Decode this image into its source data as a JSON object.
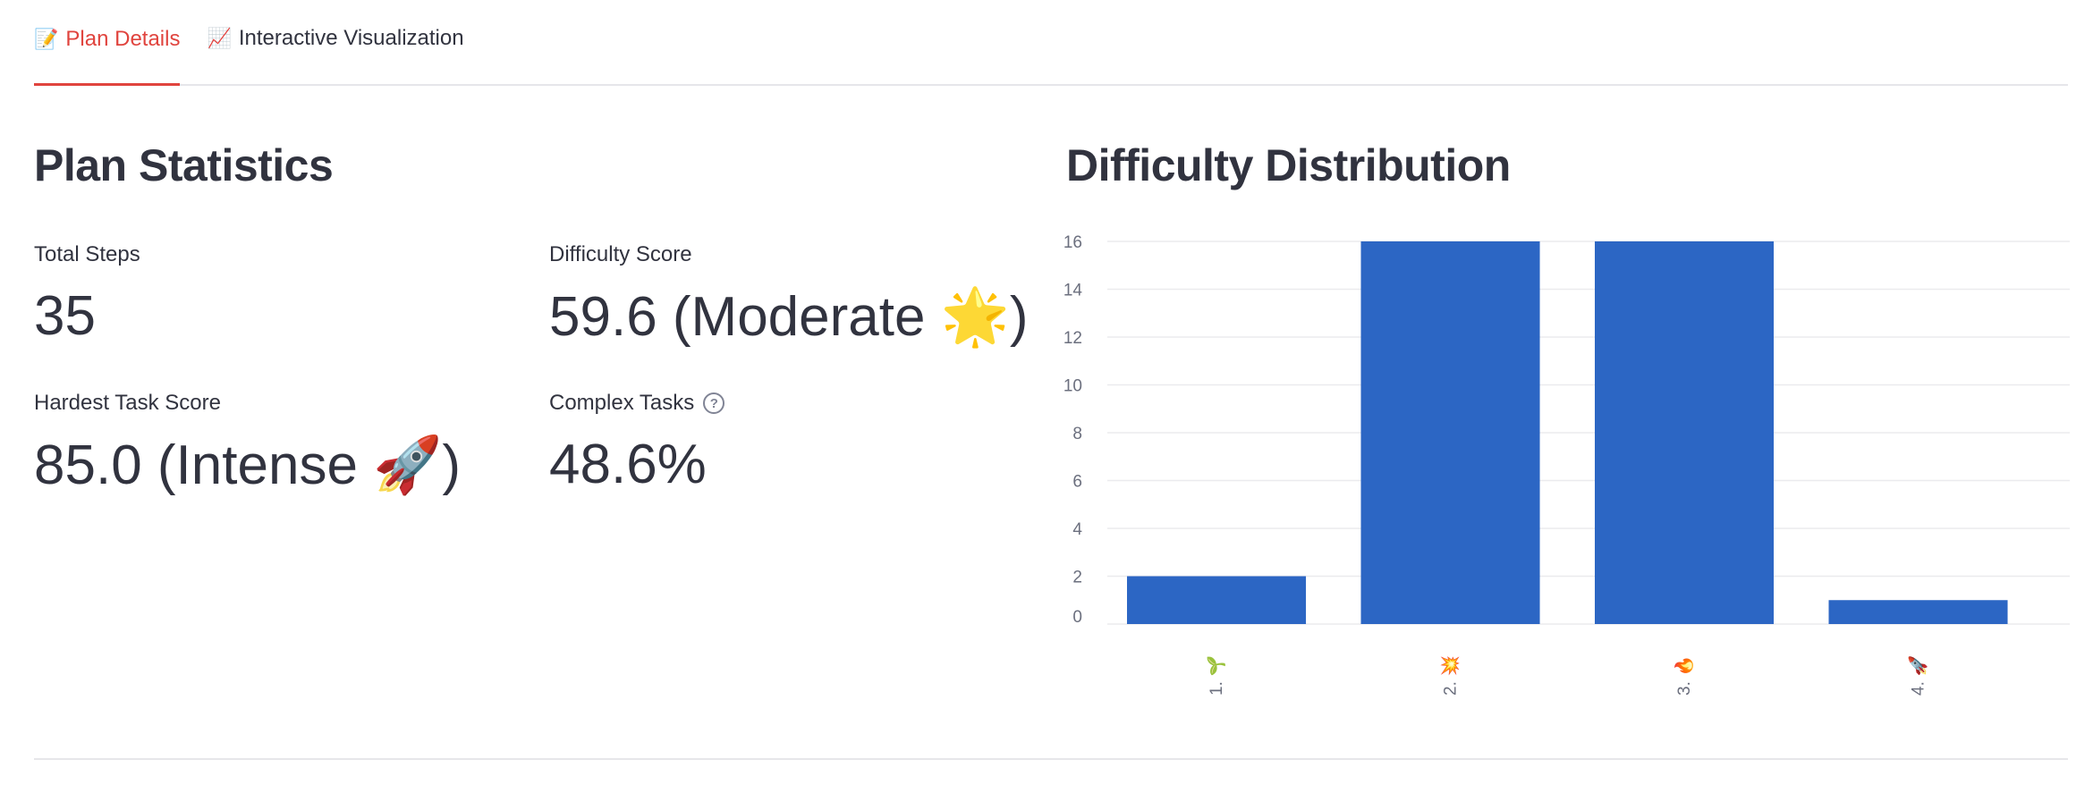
{
  "tabs": [
    {
      "icon": "📝",
      "label": "Plan Details",
      "active": true
    },
    {
      "icon": "📈",
      "label": "Interactive Visualization",
      "active": false
    }
  ],
  "left": {
    "title": "Plan Statistics",
    "metrics": {
      "total_steps": {
        "label": "Total Steps",
        "value": "35"
      },
      "difficulty_score": {
        "label": "Difficulty Score",
        "value": "59.6 (Moderate 🌟)"
      },
      "hardest_task": {
        "label": "Hardest Task Score",
        "value": "85.0 (Intense 🚀)"
      },
      "complex_tasks": {
        "label": "Complex Tasks",
        "value": "48.6%",
        "help_icon": "question-circle-icon"
      }
    }
  },
  "right": {
    "title": "Difficulty Distribution"
  },
  "chart_data": {
    "type": "bar",
    "categories": [
      "1. 🌱",
      "2. 💥",
      "3. 🔥",
      "4. 🚀"
    ],
    "values": [
      2,
      16,
      16,
      1
    ],
    "ylim": [
      0,
      16
    ],
    "yticks": [
      0,
      2,
      4,
      6,
      8,
      10,
      12,
      14,
      16
    ],
    "bar_color": "#2c66c4",
    "grid": true,
    "xlabel": "",
    "ylabel": ""
  },
  "colors": {
    "accent": "#e0443e",
    "text": "#31333f",
    "bar": "#2c66c4"
  }
}
